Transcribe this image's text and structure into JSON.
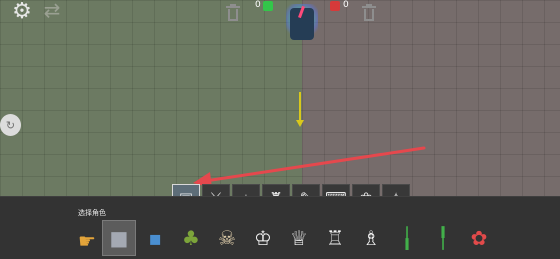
{
  "topbar": {
    "settings_icon": "gear-icon",
    "swap_icon": "swap-icon",
    "left_team": {
      "count": "0",
      "color": "#33c64a"
    },
    "right_team": {
      "count": "0",
      "color": "#d63a3a"
    }
  },
  "colors": {
    "left_field": "#6c7a62",
    "right_field": "#766c6b",
    "pointer_arrow": "#e5484d",
    "marker": "#d9c81c",
    "dock": "#333333"
  },
  "category_tabs": [
    {
      "name": "tab-characters",
      "icon": "character-icon",
      "glyph": "▣",
      "active": true
    },
    {
      "name": "tab-melee",
      "icon": "sword-icon",
      "glyph": "⚔",
      "active": false
    },
    {
      "name": "tab-ranged",
      "icon": "crosshair-icon",
      "glyph": "⌖",
      "active": false
    },
    {
      "name": "tab-traps",
      "icon": "trap-icon",
      "glyph": "♜",
      "active": false
    },
    {
      "name": "tab-explosives",
      "icon": "bomb-icon",
      "glyph": "✎",
      "active": false
    },
    {
      "name": "tab-machines",
      "icon": "machine-icon",
      "glyph": "⌨",
      "active": false
    },
    {
      "name": "tab-animals",
      "icon": "paw-icon",
      "glyph": "❀",
      "active": false
    },
    {
      "name": "tab-magic",
      "icon": "wand-icon",
      "glyph": "✧",
      "active": false
    }
  ],
  "dock": {
    "label": "选择角色",
    "slots": [
      {
        "name": "slot-robot",
        "icon": "robot-icon",
        "glyph": "■",
        "color": "#a4a9b3",
        "selected": true
      },
      {
        "name": "slot-camera-head",
        "icon": "camera-head-icon",
        "glyph": "▪",
        "color": "#4a8fd1",
        "selected": false
      },
      {
        "name": "slot-plant",
        "icon": "plant-icon",
        "glyph": "♣",
        "color": "#7ca43a",
        "selected": false
      },
      {
        "name": "slot-skull",
        "icon": "skull-icon",
        "glyph": "☠",
        "color": "#d9c8a6",
        "selected": false
      },
      {
        "name": "slot-toilet-1",
        "icon": "toilet-icon",
        "glyph": "♔",
        "color": "#f2f2f2",
        "selected": false
      },
      {
        "name": "slot-toilet-2",
        "icon": "toilet-icon",
        "glyph": "♕",
        "color": "#f2f2f2",
        "selected": false
      },
      {
        "name": "slot-toilet-3",
        "icon": "toilet-icon",
        "glyph": "♖",
        "color": "#f2f2f2",
        "selected": false
      },
      {
        "name": "slot-toilet-4",
        "icon": "toilet-icon",
        "glyph": "♗",
        "color": "#f2f2f2",
        "selected": false
      },
      {
        "name": "slot-green-tool-1",
        "icon": "green-tool-icon",
        "glyph": "╽",
        "color": "#42b04a",
        "selected": false
      },
      {
        "name": "slot-green-tool-2",
        "icon": "green-tool-icon",
        "glyph": "╿",
        "color": "#42b04a",
        "selected": false
      },
      {
        "name": "slot-toilet-flower",
        "icon": "toilet-flower-icon",
        "glyph": "✿",
        "color": "#e24a4a",
        "selected": false
      }
    ]
  }
}
